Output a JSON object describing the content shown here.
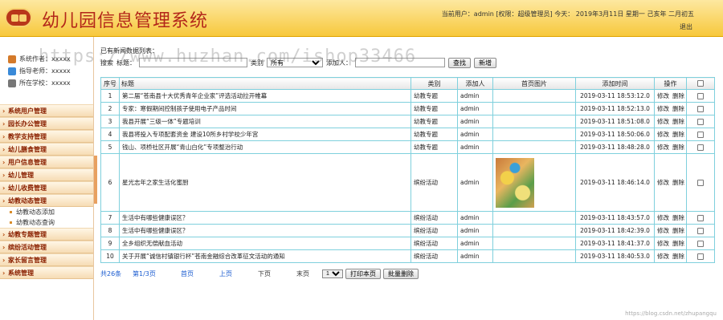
{
  "header": {
    "title": "幼儿园信息管理系统",
    "user_info": "当前用户：admin [权限：超级管理员] 今天： 2019年3月11日  星期一  己亥年 二月初五",
    "logout": "退出"
  },
  "sidebar": {
    "info": [
      {
        "label": "系统作者：xxxxx",
        "icon": "user-icon",
        "color": "#d47a2a"
      },
      {
        "label": "指导老师：xxxxx",
        "icon": "teacher-icon",
        "color": "#3a8ad8"
      },
      {
        "label": "所在学校：xxxxx",
        "icon": "school-icon",
        "color": "#777777"
      }
    ],
    "menu": [
      {
        "label": "系统用户管理"
      },
      {
        "label": "园长办公管理"
      },
      {
        "label": "教学支持管理"
      },
      {
        "label": "幼儿膳食管理"
      },
      {
        "label": "用户信息管理"
      },
      {
        "label": "幼儿管理"
      },
      {
        "label": "幼儿收费管理"
      },
      {
        "label": "幼教动态管理"
      },
      {
        "label": "幼教动态添加",
        "sub": true
      },
      {
        "label": "幼教动态查询",
        "sub": true
      },
      {
        "label": "幼教专题管理"
      },
      {
        "label": "缤纷活动管理"
      },
      {
        "label": "家长留言管理"
      },
      {
        "label": "系统管理"
      }
    ]
  },
  "main": {
    "caption": "已有新闻数据列表：",
    "search": {
      "prefix": "搜索",
      "title_label": "标题：",
      "title_value": "",
      "category_label": "类别",
      "category_selected": "所有",
      "adder_label": "添加人：",
      "adder_value": "",
      "search_button": "查找",
      "add_button": "新增"
    },
    "table": {
      "headers": [
        "序号",
        "标题",
        "类别",
        "添加人",
        "首页图片",
        "添加时间",
        "操作",
        ""
      ],
      "rows": [
        {
          "no": "1",
          "title": "第二届“苍南县十大优秀青年企业家”评选活动拉开帷幕",
          "category": "幼教专题",
          "adder": "admin",
          "image": false,
          "time": "2019-03-11 18:53:12.0"
        },
        {
          "no": "2",
          "title": "专家：寒假期间控制孩子使用电子产品时间",
          "category": "幼教专题",
          "adder": "admin",
          "image": false,
          "time": "2019-03-11 18:52:13.0"
        },
        {
          "no": "3",
          "title": "我县开展“三级一体”专题培训",
          "category": "幼教专题",
          "adder": "admin",
          "image": false,
          "time": "2019-03-11 18:51:08.0"
        },
        {
          "no": "4",
          "title": "我县将投入专项配套资金 建设10所乡村学校少年宫",
          "category": "幼教专题",
          "adder": "admin",
          "image": false,
          "time": "2019-03-11 18:50:06.0"
        },
        {
          "no": "5",
          "title": "钱山、项桥社区开展“青山白化”专项整治行动",
          "category": "幼教专题",
          "adder": "admin",
          "image": false,
          "time": "2019-03-11 18:48:28.0"
        },
        {
          "no": "6",
          "title": "星光志年之家生活化蜜厨",
          "category": "缤纷活动",
          "adder": "admin",
          "image": true,
          "time": "2019-03-11 18:46:14.0"
        },
        {
          "no": "7",
          "title": "生活中有哪些健康误区？",
          "category": "缤纷活动",
          "adder": "admin",
          "image": false,
          "time": "2019-03-11 18:43:57.0"
        },
        {
          "no": "8",
          "title": "生活中有哪些健康误区？",
          "category": "缤纷活动",
          "adder": "admin",
          "image": false,
          "time": "2019-03-11 18:42:39.0"
        },
        {
          "no": "9",
          "title": "全乡组织无偿献血活动",
          "category": "缤纷活动",
          "adder": "admin",
          "image": false,
          "time": "2019-03-11 18:41:37.0"
        },
        {
          "no": "10",
          "title": "关于开展“诚信村镇银行杯”苍南金融综合改革征文活动的通知",
          "category": "缤纷活动",
          "adder": "admin",
          "image": false,
          "time": "2019-03-11 18:40:53.0"
        }
      ],
      "op_edit": "修改",
      "op_delete": "删除"
    },
    "pager": {
      "total": "共26条",
      "page_info": "第1/3页",
      "first": "首页",
      "prev": "上页",
      "next": "下页",
      "last": "末页",
      "page_select": "1",
      "print_button": "打印本页",
      "batch_delete_button": "批量删除"
    }
  },
  "watermark": "https://www.huzhan.com/ishop33466",
  "credit": "https://blog.csdn.net/zhupangqu"
}
